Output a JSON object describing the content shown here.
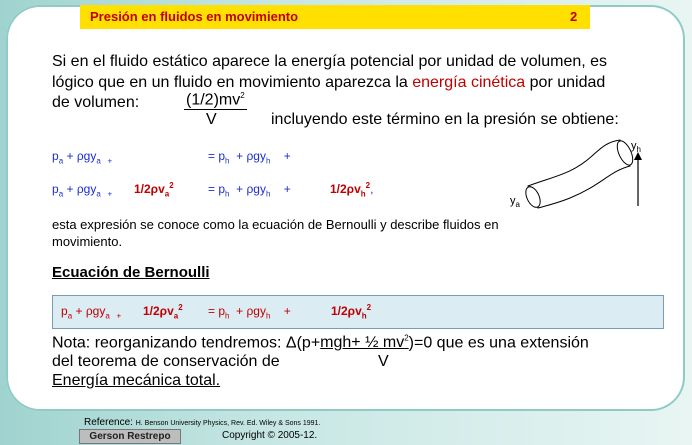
{
  "title": "Presión en fluidos en movimiento",
  "page_number": "2",
  "intro": {
    "line1": "Si en el fluido estático aparece la energía potencial por unidad de volumen, es",
    "line2_a": "lógico que en un fluido en movimiento aparezca la ",
    "line2_red": "energía  cinética",
    "line2_b": " por unidad",
    "line3_a": "de volumen:",
    "fraction_num": "(1/2)mv",
    "fraction_sup": "2",
    "fraction_den": "V",
    "line3_b": "incluyendo este término en la presión se obtiene:"
  },
  "eq1": {
    "left": "pa + ρgya  +",
    "right": "= ph  + ρgyh   +"
  },
  "eq2": {
    "left": "pa + ρgya  +",
    "left_red": "1/2ρva2",
    "right": "= ph  + ρgyh   +",
    "right_red": "1/2ρvh2",
    "comma": ","
  },
  "diagram": {
    "label_top": "yh",
    "label_bottom": "ya"
  },
  "bernoulli_desc": {
    "line1": "esta expresión se conoce como la ecuación de Bernoulli y describe fluidos en",
    "line2": "movimiento."
  },
  "section_heading": "Ecuación de Bernoulli",
  "bernoulli_eq": {
    "left": "pa + ρgya  +",
    "left_red": "1/2ρva2",
    "right": "= ph  + ρgyh   +",
    "right_red": "1/2ρvh2"
  },
  "note": {
    "line1_a": "Nota: reorganizando tendremos: Δ(p+",
    "line1_u": "mgh+ ½ mv",
    "line1_b": "2",
    "line1_c": ")=0 que es una extensión",
    "line2": "del teorema de conservación de",
    "line2_v": "V",
    "line3": "Energía mecánica total."
  },
  "footer": {
    "reference_label": "Reference:",
    "reference_text": "H. Benson University Physics, Rev. Ed. Wiley & Sons 1991.",
    "author": "Gerson Restrepo",
    "copyright": "Copyright © 2005-12."
  },
  "colors": {
    "accent_red": "#c00000",
    "title_bg": "#ffe000",
    "eq_blue": "#1c2fd0"
  }
}
